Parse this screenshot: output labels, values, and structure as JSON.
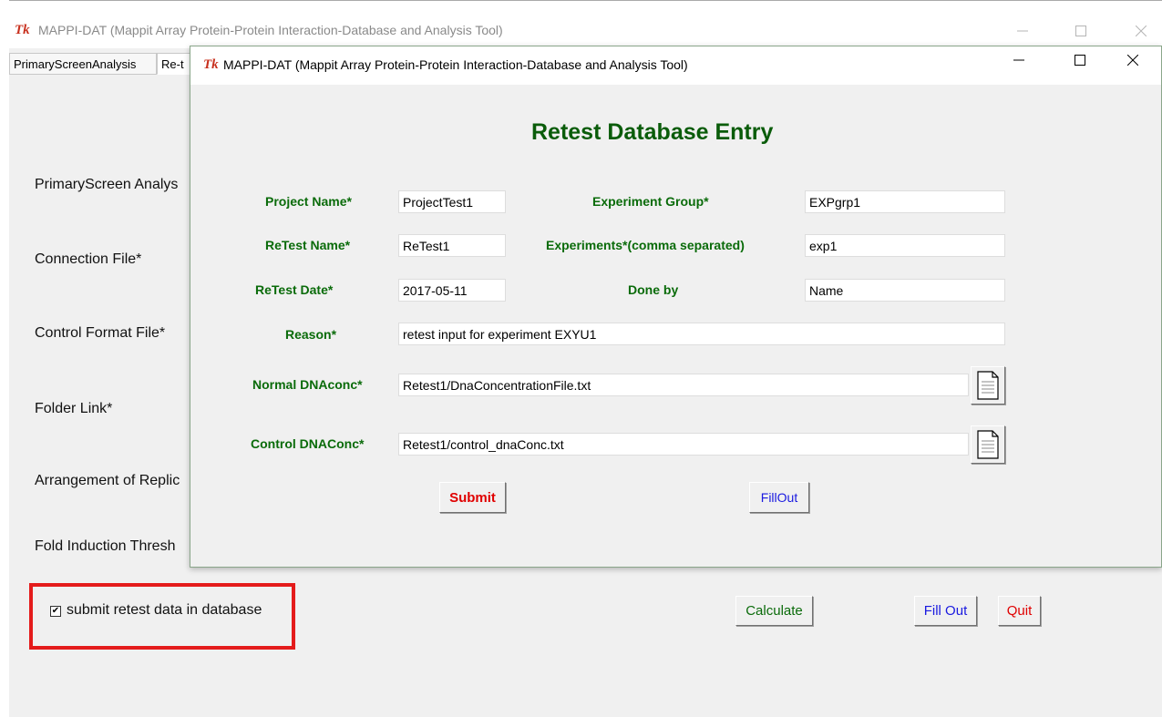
{
  "main_window": {
    "icon": "Tk",
    "title": "MAPPI-DAT (Mappit Array Protein-Protein Interaction-Database and Analysis Tool)",
    "controls": [
      "minimize-icon",
      "maximize-icon",
      "close-icon"
    ],
    "tabs": [
      {
        "label": "PrimaryScreenAnalysis"
      },
      {
        "label": "Re-t"
      }
    ],
    "labels": [
      "PrimaryScreen Analys",
      "Connection File*",
      "Control Format File*",
      "Folder Link*",
      "Arrangement of Replic",
      "Fold Induction Thresh"
    ],
    "checkbox": {
      "label": "submit retest data in database",
      "checked": true,
      "mark": "✔"
    },
    "buttons": {
      "calculate": "Calculate",
      "fill_out": "Fill Out",
      "quit": "Quit"
    },
    "colors": {
      "calculate": "#0a6b0a",
      "fill_out": "#1a1ae0",
      "quit": "#e00000",
      "highlight": "#e41b1b"
    }
  },
  "dialog": {
    "icon": "Tk",
    "title": "MAPPI-DAT (Mappit Array Protein-Protein Interaction-Database and Analysis Tool)",
    "heading": "Retest Database Entry",
    "fields": {
      "project_name": {
        "label": "Project Name*",
        "value": "ProjectTest1"
      },
      "experiment_group": {
        "label": "Experiment Group*",
        "value": "EXPgrp1"
      },
      "retest_name": {
        "label": "ReTest Name*",
        "value": "ReTest1"
      },
      "experiments": {
        "label": "Experiments*(comma separated)",
        "value": "exp1"
      },
      "retest_date": {
        "label": "ReTest Date*",
        "value": "2017-05-11"
      },
      "done_by": {
        "label": "Done by",
        "value": "Name"
      },
      "reason": {
        "label": "Reason*",
        "value": "retest input for experiment EXYU1"
      },
      "normal_dnaconc": {
        "label": "Normal DNAconc*",
        "value": "Retest1/DnaConcentrationFile.txt"
      },
      "control_dnaconc": {
        "label": "Control DNAConc*",
        "value": "Retest1/control_dnaConc.txt"
      }
    },
    "buttons": {
      "submit": "Submit",
      "fillout": "FillOut"
    },
    "file_icon": "document-icon",
    "colors": {
      "heading": "#0a5c0a",
      "label": "#0a6b0a",
      "submit": "#e00000",
      "fillout": "#1a1ae0"
    }
  }
}
